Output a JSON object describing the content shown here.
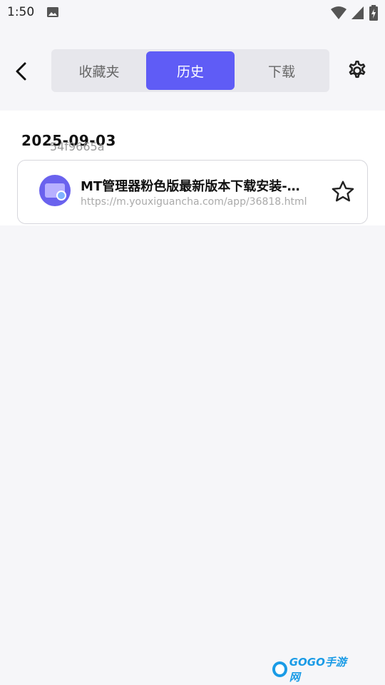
{
  "status_bar": {
    "time": "1:50"
  },
  "tabs": [
    {
      "label": "收藏夹",
      "active": false
    },
    {
      "label": "历史",
      "active": true
    },
    {
      "label": "下载",
      "active": false
    }
  ],
  "history": {
    "date": "2025-09-03",
    "ghost_text": "54f9665a",
    "items": [
      {
        "title": "MT管理器粉色版最新版本下载安装-…",
        "url": "https://m.youxiguancha.com/app/36818.html",
        "favorited": false
      }
    ]
  },
  "watermark": {
    "text": "GOGO手游网"
  },
  "colors": {
    "accent": "#5f5cf6",
    "background": "#f6f6f9"
  }
}
